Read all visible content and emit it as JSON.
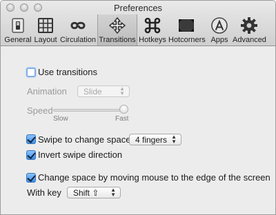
{
  "window": {
    "title": "Preferences"
  },
  "toolbar": {
    "items": [
      {
        "label": "General",
        "icon": "switch-icon",
        "selected": false
      },
      {
        "label": "Layout",
        "icon": "grid-icon",
        "selected": false
      },
      {
        "label": "Circulation",
        "icon": "loop-icon",
        "selected": false
      },
      {
        "label": "Transitions",
        "icon": "move-arrows-icon",
        "selected": true
      },
      {
        "label": "Hotkeys",
        "icon": "command-key-icon",
        "selected": false
      },
      {
        "label": "Hotcorners",
        "icon": "screen-corners-icon",
        "selected": false
      },
      {
        "label": "Apps",
        "icon": "app-store-icon",
        "selected": false
      },
      {
        "label": "Advanced",
        "icon": "gear-icon",
        "selected": false
      }
    ]
  },
  "transitions": {
    "use_transitions": {
      "label": "Use transitions",
      "checked": false
    },
    "animation": {
      "label": "Animation",
      "value": "Slide",
      "enabled": false
    },
    "speed": {
      "label": "Speed",
      "min_label": "Slow",
      "max_label": "Fast",
      "value_fraction": 1.0,
      "enabled": false
    }
  },
  "swipe": {
    "swipe_to_change": {
      "label": "Swipe to change space",
      "checked": true
    },
    "fingers": {
      "value": "4 fingers"
    },
    "invert": {
      "label": "Invert swipe direction",
      "checked": true
    }
  },
  "mouse_edge": {
    "change_space": {
      "label": "Change space by moving mouse to the edge of the screen",
      "checked": true
    },
    "with_key_label": "With key",
    "key": {
      "value": "Shift ⇧"
    }
  },
  "colors": {
    "checkbox_accent": "#3a8fe6"
  }
}
